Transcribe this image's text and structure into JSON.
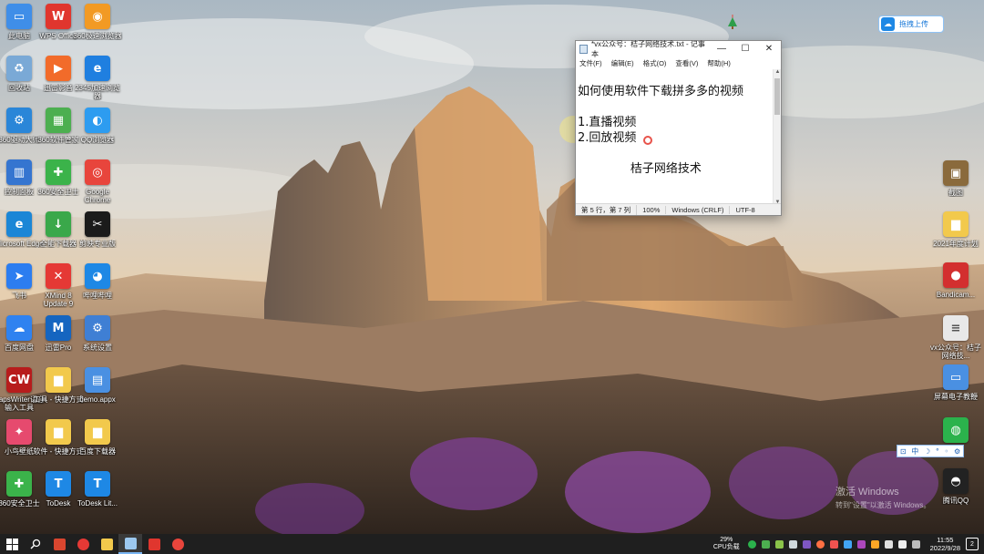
{
  "desktop_icons_left": [
    {
      "name": "desktop-icon-this-pc",
      "label": "此电脑",
      "color": "#3f8ee8",
      "glyph": "▭"
    },
    {
      "name": "desktop-icon-wps",
      "label": "WPS Office",
      "color": "#e0362e",
      "glyph": "W"
    },
    {
      "name": "desktop-icon-360-browser",
      "label": "360极速浏览器",
      "color": "#f29a24",
      "glyph": "◉"
    },
    {
      "name": "desktop-icon-recycle-bin",
      "label": "回收站",
      "color": "#7aa9d6",
      "glyph": "♻"
    },
    {
      "name": "desktop-icon-xunlei-video",
      "label": "迅雷影音",
      "color": "#f26b2a",
      "glyph": "▶"
    },
    {
      "name": "desktop-icon-2345-browser",
      "label": "2345加速浏览器",
      "color": "#1f7fe0",
      "glyph": "e"
    },
    {
      "name": "desktop-icon-360-drive",
      "label": "360驱动大师",
      "color": "#2a86d8",
      "glyph": "⚙"
    },
    {
      "name": "desktop-icon-360-software",
      "label": "360软件管家",
      "color": "#4caf50",
      "glyph": "▦"
    },
    {
      "name": "desktop-icon-qq-browser",
      "label": "QQ浏览器",
      "color": "#2d9cf0",
      "glyph": "◐"
    },
    {
      "name": "desktop-icon-control-panel",
      "label": "控制面板",
      "color": "#3575d0",
      "glyph": "▥"
    },
    {
      "name": "desktop-icon-360-security",
      "label": "360安全卫士",
      "color": "#3bb34a",
      "glyph": "✚"
    },
    {
      "name": "desktop-icon-chrome",
      "label": "Google Chrome",
      "color": "#e8453c",
      "glyph": "◎"
    },
    {
      "name": "desktop-icon-edge",
      "label": "Microsoft Edge",
      "color": "#1b86d6",
      "glyph": "e"
    },
    {
      "name": "desktop-icon-downloader",
      "label": "全能下载器",
      "color": "#3aa84a",
      "glyph": "↓"
    },
    {
      "name": "desktop-icon-capcut",
      "label": "剪映专业版",
      "color": "#1b1b1b",
      "glyph": "✂"
    },
    {
      "name": "desktop-icon-feishu",
      "label": "飞书",
      "color": "#2c7df0",
      "glyph": "➤"
    },
    {
      "name": "desktop-icon-xmind",
      "label": "XMind 8 Update 9",
      "color": "#e53935",
      "glyph": "✕"
    },
    {
      "name": "desktop-icon-bilibili",
      "label": "哔哩哔哩",
      "color": "#1e88e5",
      "glyph": "◕"
    },
    {
      "name": "desktop-icon-baidu-netdisk",
      "label": "百度网盘",
      "color": "#2f82f0",
      "glyph": "☁"
    },
    {
      "name": "desktop-icon-xunlei-pro",
      "label": "迅雷Pro",
      "color": "#1565c0",
      "glyph": "M"
    },
    {
      "name": "desktop-icon-settings",
      "label": "系统设置",
      "color": "#3f7fd4",
      "glyph": "⚙"
    },
    {
      "name": "desktop-icon-capwriter",
      "label": "CapsWriter语音输入工具",
      "color": "#b71c1c",
      "glyph": "CW"
    },
    {
      "name": "desktop-icon-tools-folder",
      "label": "工具 - 快捷方式",
      "color": "#f2c94c",
      "glyph": "▆"
    },
    {
      "name": "desktop-icon-demo-app",
      "label": "demo.appx",
      "color": "#4a90e2",
      "glyph": "▤"
    },
    {
      "name": "desktop-icon-xiaoniao",
      "label": "小鸟壁纸",
      "color": "#e64a6e",
      "glyph": "✦"
    },
    {
      "name": "desktop-icon-software-folder",
      "label": "软件 - 快捷方式",
      "color": "#f2c94c",
      "glyph": "▆"
    },
    {
      "name": "desktop-icon-downloads-folder",
      "label": "百度下载器",
      "color": "#f2c94c",
      "glyph": "▆"
    },
    {
      "name": "desktop-icon-360-guard",
      "label": "360安全卫士",
      "color": "#3bb34a",
      "glyph": "✚"
    },
    {
      "name": "desktop-icon-todesk",
      "label": "ToDesk",
      "color": "#1e88e5",
      "glyph": "T"
    },
    {
      "name": "desktop-icon-todesk-lite",
      "label": "ToDesk Lit...",
      "color": "#1e88e5",
      "glyph": "T"
    }
  ],
  "desktop_icons_right": [
    {
      "name": "desktop-icon-right-image",
      "label": "截图",
      "color": "#8a6a3c",
      "glyph": "▣"
    },
    {
      "name": "desktop-icon-right-folder",
      "label": "2021年度计划",
      "color": "#f2c94c",
      "glyph": "▆"
    },
    {
      "name": "desktop-icon-bandicam",
      "label": "Bandicam...",
      "color": "#d32f2f",
      "glyph": "●"
    },
    {
      "name": "desktop-icon-vx-txt",
      "label": "vx公众号：桔子网络技...",
      "color": "#e8e8e8",
      "glyph": "≡"
    },
    {
      "name": "desktop-icon-screen-capture",
      "label": "屏幕电子教鞭",
      "color": "#4a90e2",
      "glyph": "▭"
    },
    {
      "name": "desktop-icon-wechat",
      "label": "微信",
      "color": "#2bb24c",
      "glyph": "◍"
    },
    {
      "name": "desktop-icon-qq",
      "label": "腾讯QQ",
      "color": "#222222",
      "glyph": "◓"
    }
  ],
  "upload_button": {
    "label": "拖拽上传"
  },
  "notepad": {
    "title": "*vx公众号：桔子网络技术.txt - 记事本",
    "controls": {
      "minimize": "—",
      "maximize": "☐",
      "close": "✕"
    },
    "menu": [
      "文件(F)",
      "编辑(E)",
      "格式(O)",
      "查看(V)",
      "帮助(H)"
    ],
    "lines": [
      "如何使用软件下载拼多多的视频",
      "",
      "1.直播视频",
      "2.回放视频",
      "",
      "              桔子网络技术"
    ],
    "status": {
      "position": "第 5 行，第 7 列",
      "zoom": "100%",
      "line_ending": "Windows (CRLF)",
      "encoding": "UTF-8"
    }
  },
  "ime": {
    "items": [
      "⊡",
      "中",
      "☽",
      "°",
      "◦",
      "⚙"
    ]
  },
  "activation": {
    "title": "激活 Windows",
    "subtitle": "转到\"设置\"以激活 Windows。"
  },
  "taskbar": {
    "cpu_percent": "29%",
    "cpu_label": "CPU负载",
    "time": "11:55",
    "date": "2022/9/28",
    "notification_count": "2"
  }
}
